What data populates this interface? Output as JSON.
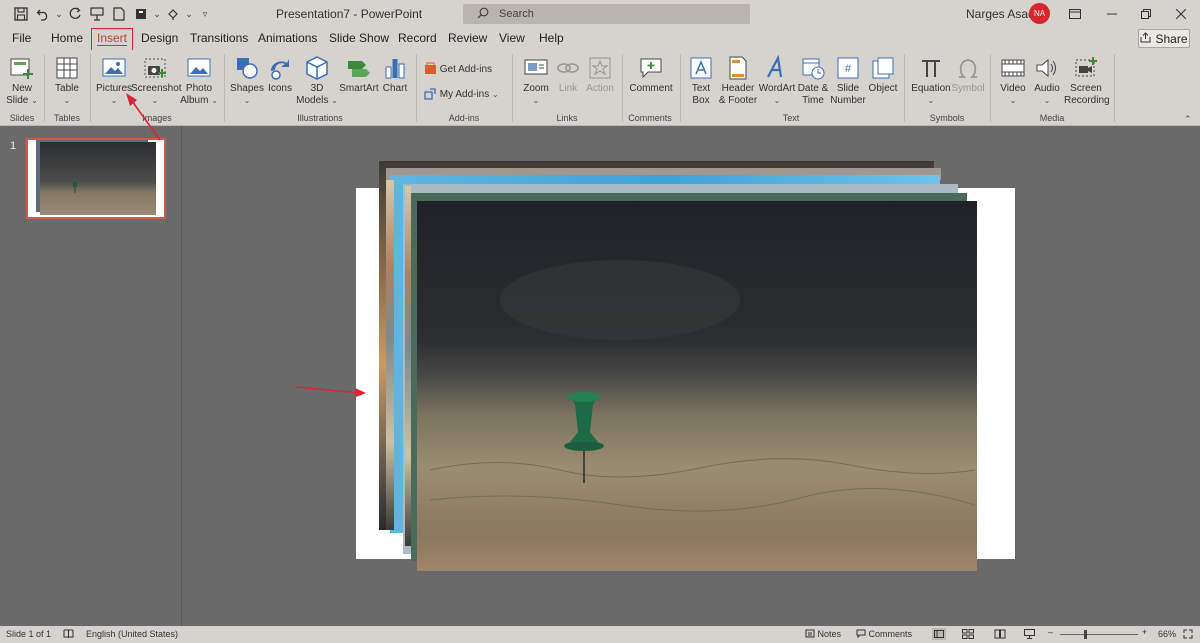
{
  "title_bar": {
    "document_title": "Presentation7  -  PowerPoint",
    "search_placeholder": "Search",
    "user_name": "Narges Asadi",
    "user_initials": "NA"
  },
  "tabs": [
    "File",
    "Home",
    "Insert",
    "Design",
    "Transitions",
    "Animations",
    "Slide Show",
    "Record",
    "Review",
    "View",
    "Help"
  ],
  "active_tab": "Insert",
  "share_label": "Share",
  "ribbon": {
    "new_slide": [
      "New",
      "Slide"
    ],
    "table": "Table",
    "pictures": "Pictures",
    "screenshot": "Screenshot",
    "photo_album": [
      "Photo",
      "Album"
    ],
    "shapes": "Shapes",
    "icons": "Icons",
    "models_3d": [
      "3D",
      "Models"
    ],
    "smartart": "SmartArt",
    "chart": "Chart",
    "get_addins": "Get Add-ins",
    "my_addins": "My Add-ins",
    "zoom": "Zoom",
    "link": "Link",
    "action": "Action",
    "comment": "Comment",
    "text_box": [
      "Text",
      "Box"
    ],
    "header_footer": [
      "Header",
      "& Footer"
    ],
    "wordart": "WordArt",
    "date_time": [
      "Date &",
      "Time"
    ],
    "slide_number": [
      "Slide",
      "Number"
    ],
    "object": "Object",
    "equation": "Equation",
    "symbol": "Symbol",
    "video": "Video",
    "audio": "Audio",
    "screen_recording": [
      "Screen",
      "Recording"
    ],
    "groups": {
      "slides": "Slides",
      "tables": "Tables",
      "images": "Images",
      "illustrations": "Illustrations",
      "addins": "Add-ins",
      "links": "Links",
      "comments": "Comments",
      "text": "Text",
      "symbols": "Symbols",
      "media": "Media"
    }
  },
  "slide_panel": {
    "slide_number": "1"
  },
  "status_bar": {
    "slide_info": "Slide 1 of 1",
    "language": "English (United States)",
    "notes": "Notes",
    "comments": "Comments",
    "zoom_level": "66%"
  },
  "colors": {
    "chrome": "#d6d2cd",
    "workspace": "#6a6a6a",
    "accent": "#b7472a",
    "highlight_red": "#e0232e"
  }
}
